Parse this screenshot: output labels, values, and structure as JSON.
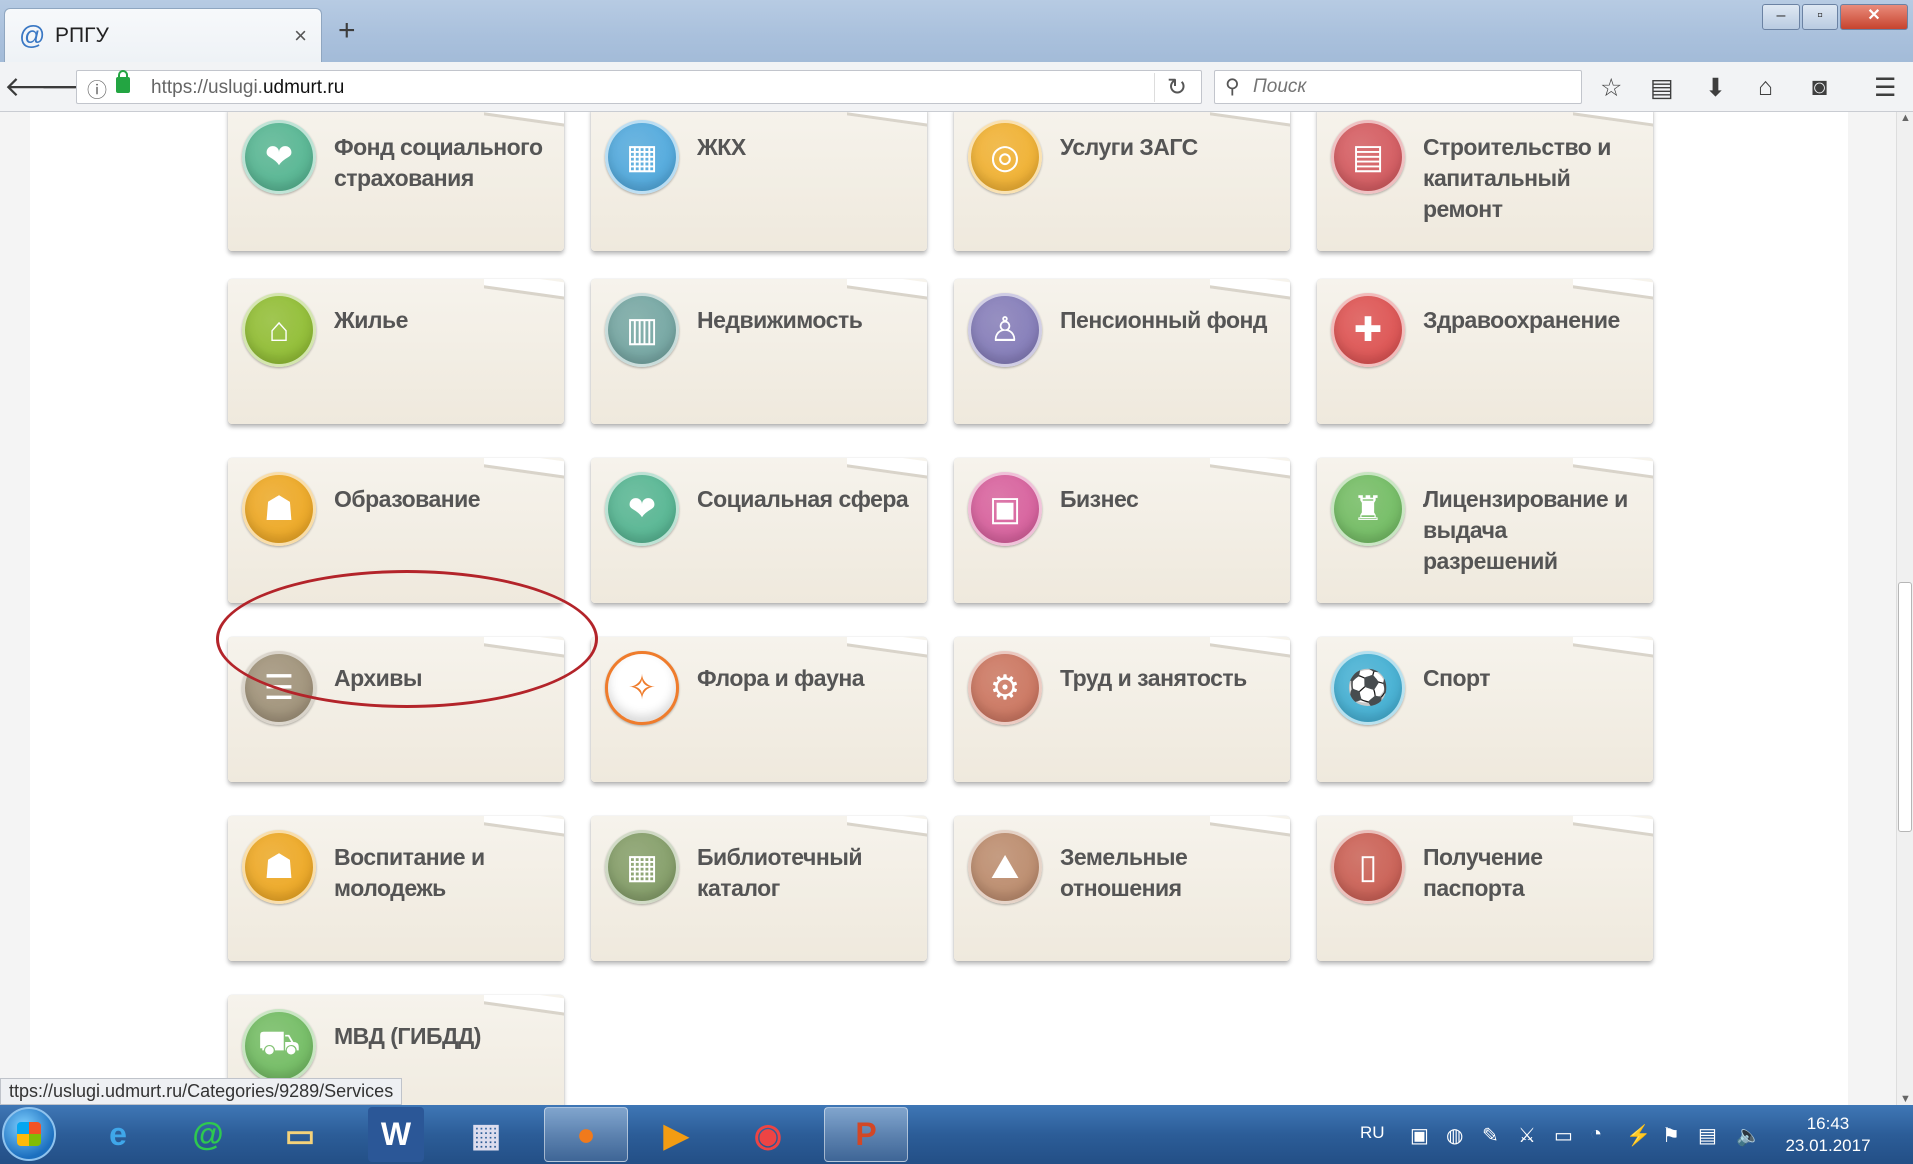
{
  "browser": {
    "tab_title": "РПГУ",
    "tab_close": "×",
    "new_tab": "+",
    "url_prefix": "https://uslugi.",
    "url_domain": "udmurt.ru",
    "search_placeholder": "Поиск",
    "status_url": "ttps://uslugi.udmurt.ru/Categories/9289/Services"
  },
  "tiles": [
    {
      "label": "Фонд социального страхования",
      "icon": "handshake-heart-icon",
      "color": "#4fb38f",
      "glyph": "❤"
    },
    {
      "label": "ЖКХ",
      "icon": "apartment-building-icon",
      "color": "#4aa6dd",
      "glyph": "▦"
    },
    {
      "label": "Услуги ЗАГС",
      "icon": "wedding-rings-icon",
      "color": "#f0ae2a",
      "glyph": "◎"
    },
    {
      "label": "Строительство и капитальный ремонт",
      "icon": "construction-crane-icon",
      "color": "#d2545a",
      "glyph": "▤"
    },
    {
      "label": "Жилье",
      "icon": "house-icon",
      "color": "#8cbb2c",
      "glyph": "⌂"
    },
    {
      "label": "Недвижимость",
      "icon": "map-icon",
      "color": "#6fa3a0",
      "glyph": "▥"
    },
    {
      "label": "Пенсионный фонд",
      "icon": "elderly-person-icon",
      "color": "#7f77b7",
      "glyph": "♙"
    },
    {
      "label": "Здравоохранение",
      "icon": "medical-cross-icon",
      "color": "#dc4c4c",
      "glyph": "✚"
    },
    {
      "label": "Образование",
      "icon": "parent-child-icon",
      "color": "#eda51c",
      "glyph": "☗"
    },
    {
      "label": "Социальная сфера",
      "icon": "handshake-heart-icon",
      "color": "#4fb38f",
      "glyph": "❤"
    },
    {
      "label": "Бизнес",
      "icon": "briefcase-icon",
      "color": "#d65a9a",
      "glyph": "▣"
    },
    {
      "label": "Лицензирование и выдача разрешений",
      "icon": "stamp-icon",
      "color": "#6dba5e",
      "glyph": "♜"
    },
    {
      "label": "Архивы",
      "icon": "archive-box-icon",
      "color": "#9c8e75",
      "glyph": "☰"
    },
    {
      "label": "Флора и фауна",
      "icon": "deer-icon",
      "color": "#ffffff",
      "glyph": "✧"
    },
    {
      "label": "Труд и занятость",
      "icon": "gears-icon",
      "color": "#c9705a",
      "glyph": "⚙"
    },
    {
      "label": "Спорт",
      "icon": "soccer-ball-icon",
      "color": "#3cadd3",
      "glyph": "⚽"
    },
    {
      "label": "Воспитание и молодежь",
      "icon": "parent-child-icon",
      "color": "#eda51c",
      "glyph": "☗"
    },
    {
      "label": "Библиотечный каталог",
      "icon": "card-catalog-icon",
      "color": "#7f9a63",
      "glyph": "▦"
    },
    {
      "label": "Земельные отношения",
      "icon": "land-map-pin-icon",
      "color": "#b98768",
      "glyph": "⛰"
    },
    {
      "label": "Получение паспорта",
      "icon": "passport-icon",
      "color": "#c8594e",
      "glyph": "▯"
    },
    {
      "label": "МВД (ГИБДД)",
      "icon": "car-icon",
      "color": "#6dba5e",
      "glyph": "⛟"
    }
  ],
  "tray": {
    "lang": "RU",
    "time": "16:43",
    "date": "23.01.2017"
  }
}
